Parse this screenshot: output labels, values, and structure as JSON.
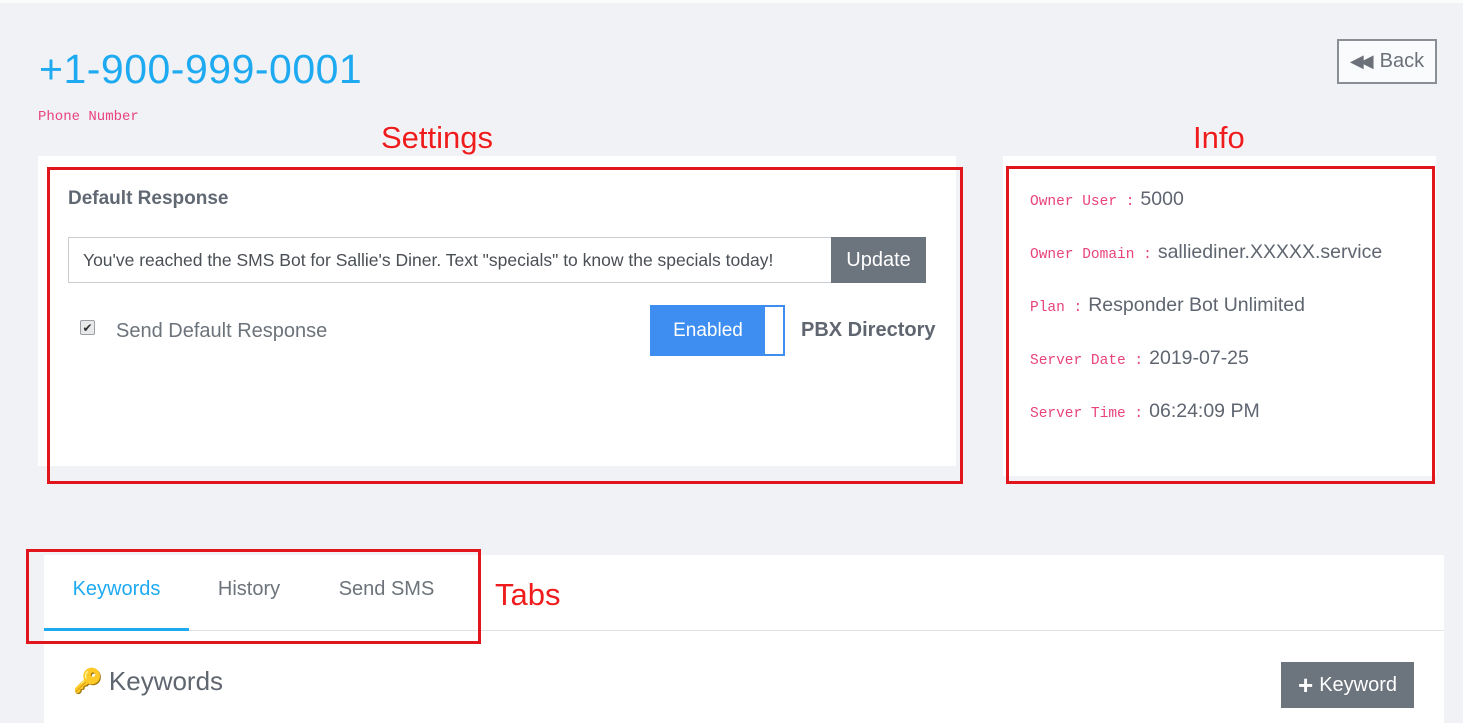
{
  "header": {
    "phone_number": "+1-900-999-0001",
    "phone_label": "Phone Number",
    "back_label": "Back",
    "back_icon": "fast-backward-icon"
  },
  "annotations": {
    "settings": "Settings",
    "info": "Info",
    "tabs": "Tabs"
  },
  "settings": {
    "default_response_title": "Default Response",
    "default_response_value": "You've reached the SMS Bot for Sallie's Diner.  Text \"specials\" to know the specials today!",
    "update_label": "Update",
    "send_default_checked": true,
    "send_default_label": "Send Default Response",
    "pbx_toggle_label": "Enabled",
    "pbx_label": "PBX Directory"
  },
  "info": {
    "owner_user_key": "Owner User :",
    "owner_user": "5000",
    "owner_domain_key": "Owner Domain :",
    "owner_domain": "salliediner.XXXXX.service",
    "plan_key": "Plan :",
    "plan": "Responder Bot Unlimited",
    "server_date_key": "Server Date :",
    "server_date": "2019-07-25",
    "server_time_key": "Server Time :",
    "server_time": "06:24:09 PM"
  },
  "tabs": {
    "items": [
      {
        "label": "Keywords",
        "active": true
      },
      {
        "label": "History",
        "active": false
      },
      {
        "label": "Send SMS",
        "active": false
      }
    ]
  },
  "keywords": {
    "title": "Keywords",
    "title_icon": "key-icon",
    "add_label": "Keyword",
    "add_icon": "plus-icon"
  },
  "colors": {
    "accent": "#1eaaf1",
    "annotation_red": "#e1161c",
    "label_pink": "#e8437c",
    "toggle_blue": "#3d8ef0",
    "button_gray": "#6c747d"
  }
}
